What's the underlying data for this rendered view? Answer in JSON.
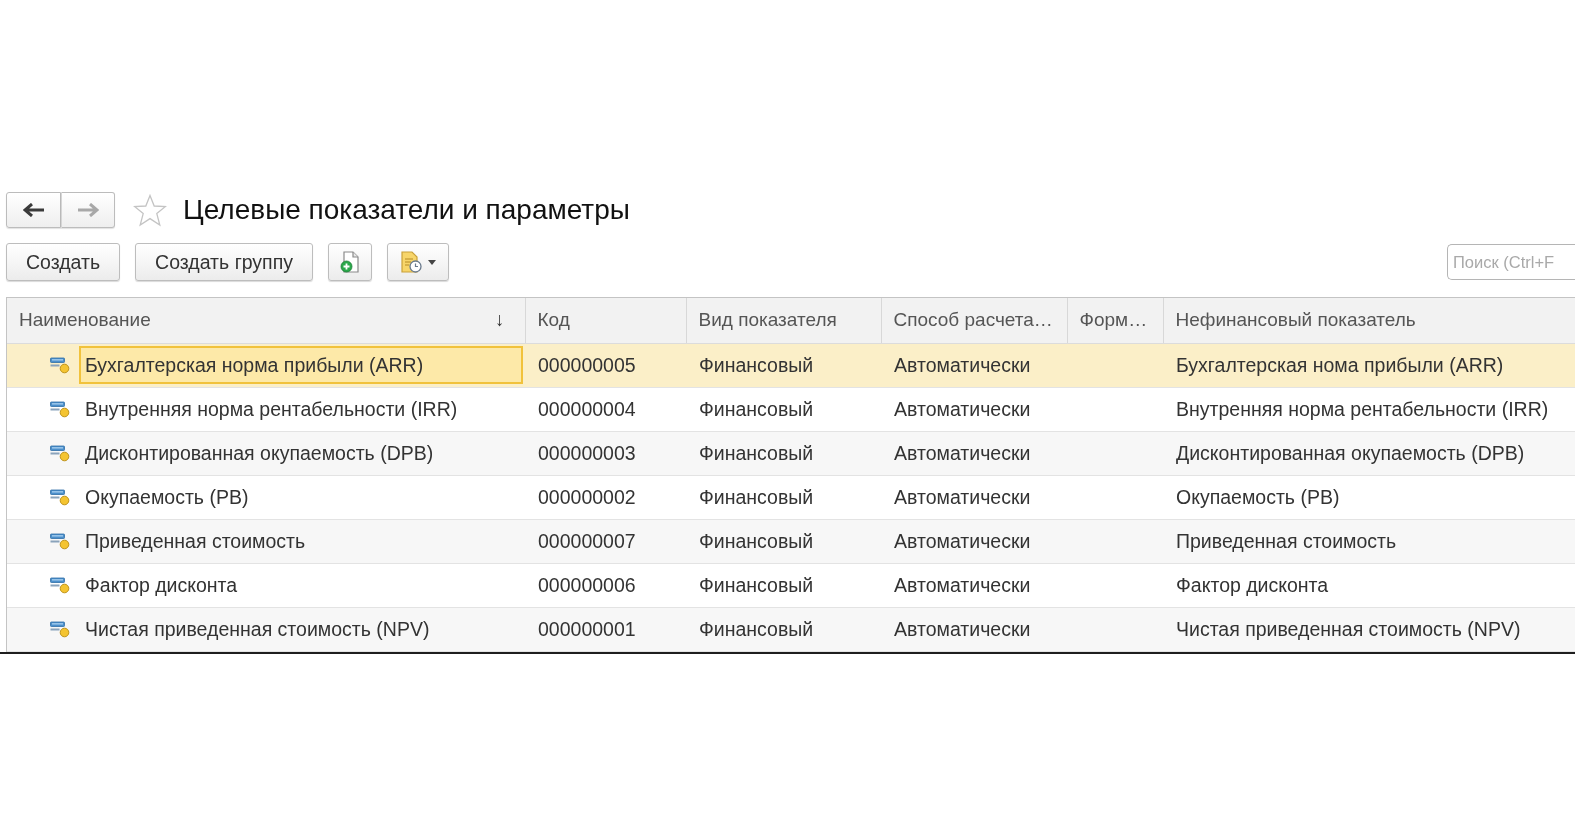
{
  "navigation": {
    "back": {
      "disabled": false
    },
    "forward": {
      "disabled": true
    }
  },
  "favorite": false,
  "title": "Целевые показатели и параметры",
  "toolbar": {
    "buttons": [
      {
        "kind": "text",
        "label": "Создать"
      },
      {
        "kind": "text",
        "label": "Создать группу"
      },
      {
        "kind": "add"
      },
      {
        "kind": "menu"
      }
    ],
    "search": {
      "placeholder": "Поиск (Ctrl+F"
    }
  },
  "table": {
    "columns": [
      {
        "label": "Наименование",
        "sort_indicator": "↓"
      },
      {
        "label": "Код"
      },
      {
        "label": "Вид показателя"
      },
      {
        "label": "Способ расчета…"
      },
      {
        "label": "Форм…"
      },
      {
        "label": "Нефинансовый показатель"
      }
    ],
    "rows": [
      {
        "selected": true,
        "name": "Бухгалтерская норма прибыли (ARR)",
        "code": "000000005",
        "indicator_type": "Финансовый",
        "calculation_method": "Автоматически",
        "non_financial_indicator": "Бухгалтерская нома прибыли (ARR)"
      },
      {
        "selected": false,
        "name": "Внутренняя норма рентабельности (IRR)",
        "code": "000000004",
        "indicator_type": "Финансовый",
        "calculation_method": "Автоматически",
        "non_financial_indicator": "Внутренняя норма рентабельности (IRR)"
      },
      {
        "selected": false,
        "name": "Дисконтированная окупаемость (DPB)",
        "code": "000000003",
        "indicator_type": "Финансовый",
        "calculation_method": "Автоматически",
        "non_financial_indicator": "Дисконтированная окупаемость (DPB)"
      },
      {
        "selected": false,
        "name": "Окупаемость (PB)",
        "code": "000000002",
        "indicator_type": "Финансовый",
        "calculation_method": "Автоматически",
        "non_financial_indicator": "Окупаемость (PB)"
      },
      {
        "selected": false,
        "name": "Приведенная стоимость",
        "code": "000000007",
        "indicator_type": "Финансовый",
        "calculation_method": "Автоматически",
        "non_financial_indicator": "Приведенная стоимость"
      },
      {
        "selected": false,
        "name": "Фактор дисконта",
        "code": "000000006",
        "indicator_type": "Финансовый",
        "calculation_method": "Автоматически",
        "non_financial_indicator": "Фактор дисконта"
      },
      {
        "selected": false,
        "name": "Чистая приведенная стоимость (NPV)",
        "code": "000000001",
        "indicator_type": "Финансовый",
        "calculation_method": "Автоматически",
        "non_financial_indicator": "Чистая приведенная стоимость (NPV)"
      }
    ]
  }
}
